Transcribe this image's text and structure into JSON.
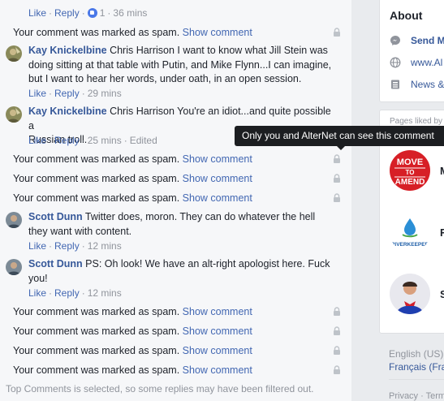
{
  "actions": {
    "like": "Like",
    "reply": "Reply",
    "sep": "·"
  },
  "top_row": {
    "reactions_count": "1",
    "time": "36 mins"
  },
  "spam": {
    "text": "Your comment was marked as spam.",
    "show": "Show comment"
  },
  "comments": [
    {
      "author": "Kay Knickelbine",
      "lines": [
        "Chris Harrison I want to know what Jill Stein was",
        "doing sitting at that table with Putin, and Mike Flynn...I can imagine,",
        "but I want to hear her words, under oath, in an open session."
      ],
      "time": "29 mins"
    },
    {
      "author": "Kay Knickelbine",
      "lines": [
        "Chris Harrison You're an idiot...and quite possible a",
        "Russian troll."
      ],
      "time": "25 mins",
      "edited": "Edited"
    },
    {
      "author": "Scott Dunn",
      "lines": [
        "Twitter does, moron. They can do whatever the hell",
        "they want with content."
      ],
      "time": "12 mins"
    },
    {
      "author": "Scott Dunn",
      "lines": [
        "PS: Oh look! We have an alt-right apologist here. Fuck",
        "you!"
      ],
      "time": "12 mins"
    }
  ],
  "tooltip": "Only you and AlterNet can see this comment",
  "footer_note": "Top Comments is selected, so some replies may have been filtered out.",
  "sidebar": {
    "about_title": "About",
    "about_items": [
      {
        "icon": "messenger-icon",
        "label": "Send M"
      },
      {
        "icon": "globe-icon",
        "label": "www.Al"
      },
      {
        "icon": "news-icon",
        "label": "News &"
      }
    ],
    "liked_heading": "Pages liked by",
    "pages": [
      {
        "thumb_lines": [
          "MOVE",
          "TO",
          "AMEND"
        ],
        "initial": "M"
      },
      {
        "thumb_text": "RIVERKEEPER",
        "initial": "R"
      },
      {
        "initial": "S"
      }
    ],
    "language_current": "English (US)",
    "language_alt": "Français (Fra",
    "privacy": "Privacy · Terms"
  },
  "colors": {
    "link": "#4267b2",
    "author": "#365899",
    "meta": "#90949c",
    "tooltip_bg": "#1c1e21",
    "feed_bg": "#f6f7f9",
    "page_bg": "#e9ebee"
  }
}
